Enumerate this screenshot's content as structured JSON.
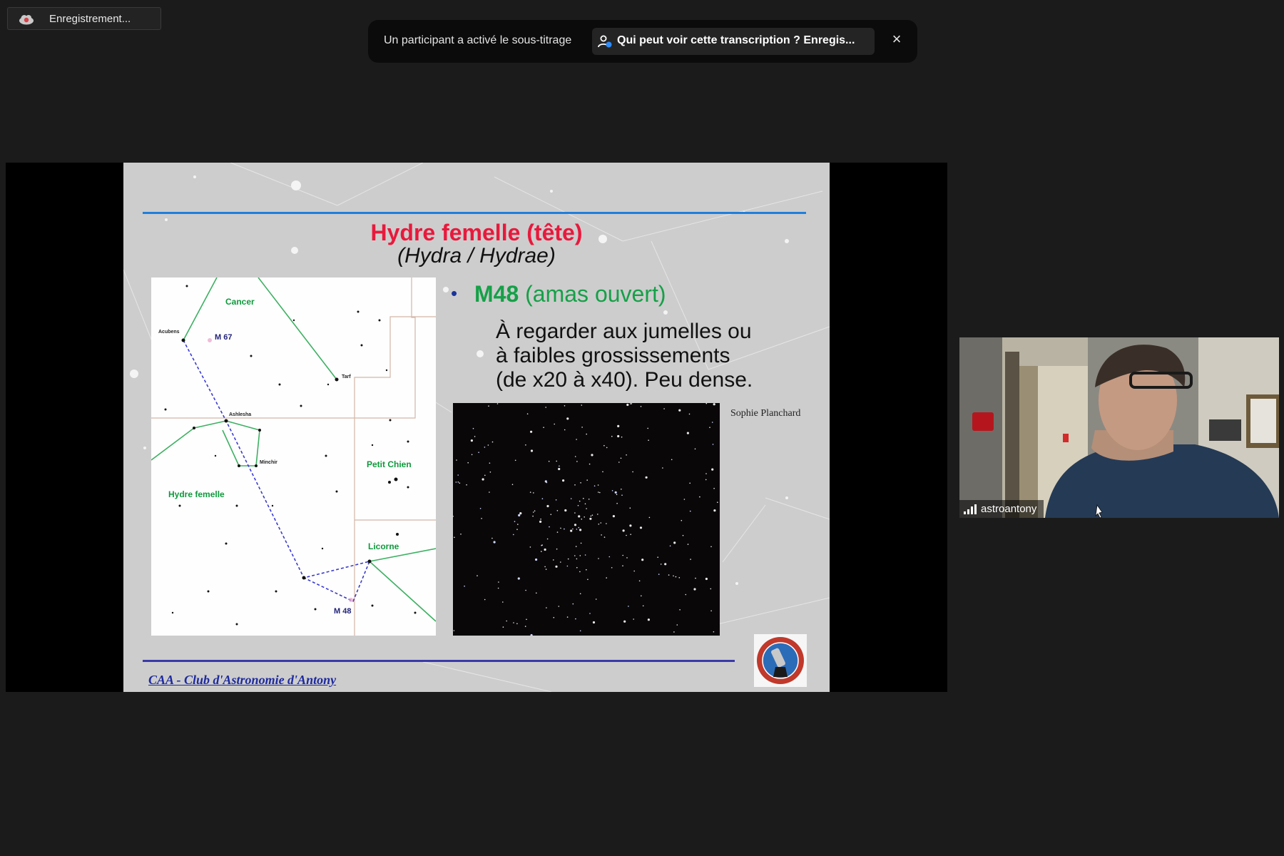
{
  "recording": {
    "label": "Enregistrement..."
  },
  "banner": {
    "message": "Un participant a activé le sous-titrage",
    "chip_text": "Qui peut voir cette transcription ? Enregis...",
    "close_symbol": "×"
  },
  "slide": {
    "title": "Hydre femelle (tête)",
    "subtitle": "(Hydra / Hydrae)",
    "bullet_symbol": "•",
    "bullet_object": "M48",
    "bullet_type": "(amas ouvert)",
    "desc_lines": [
      "À regarder aux jumelles ou",
      "à faibles grossissements",
      "(de x20 à x40). Peu dense."
    ],
    "photo_credit": "Sophie Planchard",
    "footer": "CAA - Club d'Astronomie d'Antony",
    "map": {
      "constellations": [
        "Cancer",
        "Hydre femelle",
        "Petit Chien",
        "Licorne"
      ],
      "objects": [
        "M 67",
        "M 48"
      ],
      "stars": [
        "Acubens",
        "Tarf",
        "Ashlesha",
        "Minchir"
      ]
    }
  },
  "participant": {
    "name": "astroantony"
  },
  "colors": {
    "title": "#e8193c",
    "bullet_heading": "#16a048",
    "footer": "#1d2a9e",
    "rule_top": "#1f7fdc",
    "rule_bottom": "#3a3aa8"
  }
}
